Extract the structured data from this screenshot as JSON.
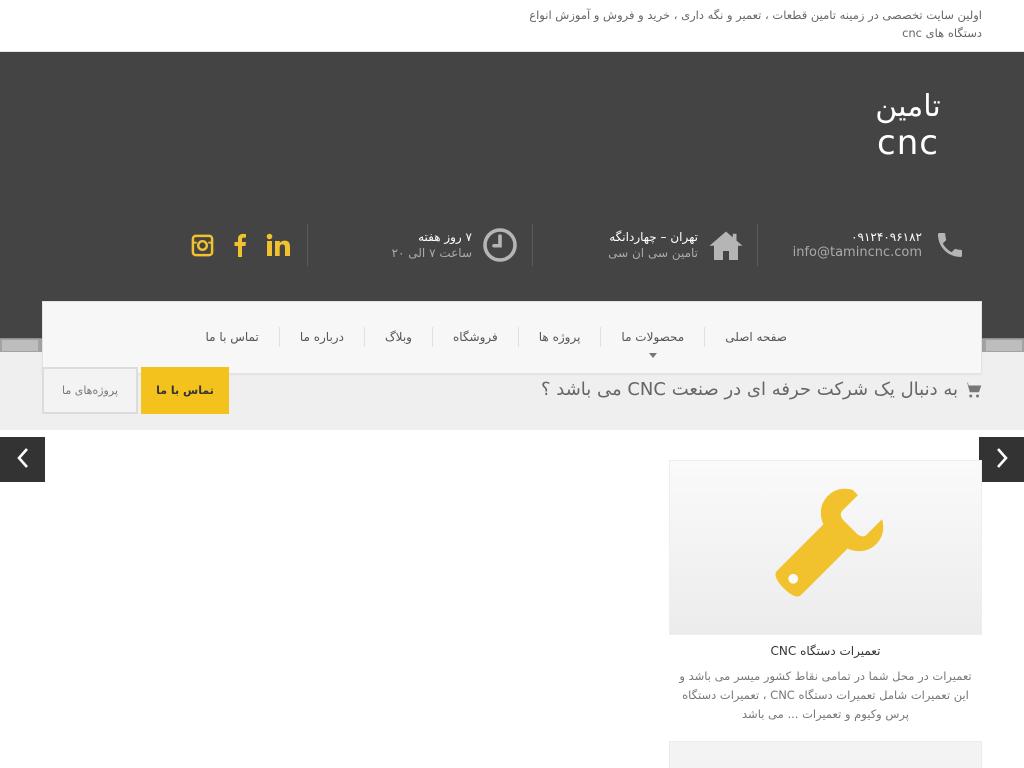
{
  "topbar": {
    "tagline": "اولین سایت تخصصی در زمینه تامین قطعات ، تعمیر و نگه داری ، خرید و فروش و آموزش انواع دستگاه های cnc"
  },
  "logo": {
    "line1": "تامین",
    "line2": "cnc"
  },
  "contact": {
    "phone": "۰۹۱۲۴۰۹۶۱۸۲",
    "email": "info@tamincnc.com",
    "address_line1": "تهران – چهاردانگه",
    "address_line2": "تامین سی ان سی",
    "hours_line1": "۷ روز هفته",
    "hours_line2": "ساعت ۷ الی ۲۰"
  },
  "nav": {
    "items": [
      {
        "label": "صفحه اصلی"
      },
      {
        "label": "محصولات ما"
      },
      {
        "label": "پروژه ها"
      },
      {
        "label": "فروشگاه"
      },
      {
        "label": "وبلاگ"
      },
      {
        "label": "درباره ما"
      },
      {
        "label": "تماس با ما"
      }
    ]
  },
  "cta": {
    "text": "به دنبال یک شرکت حرفه ای در صنعت CNC می باشد ؟",
    "contact_button": "تماس با ما",
    "projects_button": "پروژه‌های ما"
  },
  "card": {
    "icon": "wrench-icon",
    "title": "تعمیرات دستگاه CNC",
    "description": "تعمیرات در محل شما در تمامی نقاط کشور میسر می باشد و این تعمیرات شامل تعمیرات دستگاه CNC ، تعمیرات دستگاه پرس وکیوم و تعمیرات ... می باشد"
  },
  "colors": {
    "accent": "#f4c21d",
    "header_bg": "#444444",
    "icon_gray": "#b5b5b5"
  }
}
